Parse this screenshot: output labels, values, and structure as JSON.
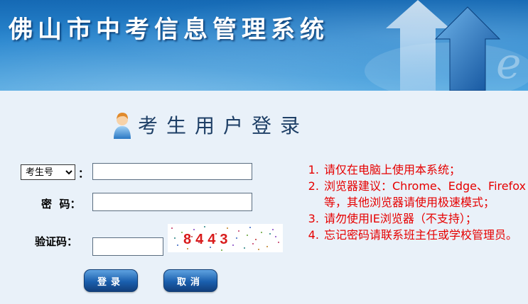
{
  "header": {
    "title": "佛山市中考信息管理系统",
    "brand_color": "#1a6fbb"
  },
  "login": {
    "heading": "考生用户登录",
    "user_type": {
      "selected": "考生号",
      "options": [
        "考生号"
      ]
    },
    "colon": "：",
    "username_value": "",
    "password_label": "密  码：",
    "password_value": "",
    "captcha_label": "验证码：",
    "captcha_input_value": "",
    "captcha_text": "8443",
    "login_button": "登录",
    "cancel_button": "取消"
  },
  "notices": [
    "请仅在电脑上使用本系统；",
    "浏览器建议：Chrome、Edge、Firefox等，其他浏览器请使用极速模式；",
    "请勿使用IE浏览器（不支持）；",
    "忘记密码请联系班主任或学校管理员。"
  ],
  "colors": {
    "notice_text": "#e60000",
    "page_background": "#e9f1f9",
    "heading_text": "#1e3f66"
  }
}
